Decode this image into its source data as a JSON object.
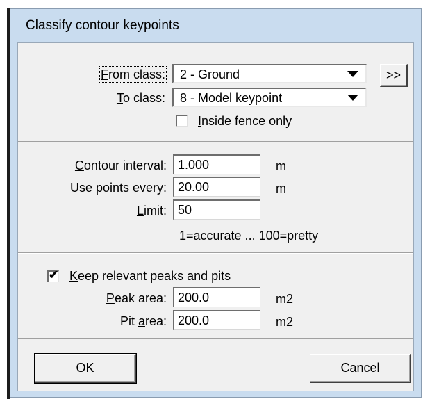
{
  "dialog": {
    "title": "Classify contour keypoints"
  },
  "classes": {
    "from_label_pre": "F",
    "from_label_post": "rom class:",
    "from_value": "2 - Ground",
    "to_label_pre": "T",
    "to_label_post": "o class:",
    "to_value": "8 - Model keypoint",
    "swap_label": ">>",
    "fence_label_pre": "I",
    "fence_label_post": "nside fence only",
    "fence_checked": false
  },
  "contour": {
    "interval_label_pre": "C",
    "interval_label_post": "ontour interval:",
    "interval_value": "1.000",
    "interval_unit": "m",
    "every_label_pre": "U",
    "every_label_post": "se points every:",
    "every_value": "20.00",
    "every_unit": "m",
    "limit_label_pre": "L",
    "limit_label_post": "imit:",
    "limit_value": "50",
    "limit_hint": "1=accurate ... 100=pretty"
  },
  "peaks": {
    "keep_label_pre": "K",
    "keep_label_post": "eep relevant peaks and pits",
    "keep_checked": true,
    "keep_mark": "✔",
    "peak_label_pre": "P",
    "peak_label_post": "eak area:",
    "peak_value": "200.0",
    "peak_unit": "m2",
    "pit_label_pre": "Pit ",
    "pit_label_u": "a",
    "pit_label_post": "rea:",
    "pit_value": "200.0",
    "pit_unit": "m2"
  },
  "buttons": {
    "ok_pre": "O",
    "ok_post": "K",
    "cancel": "Cancel"
  }
}
